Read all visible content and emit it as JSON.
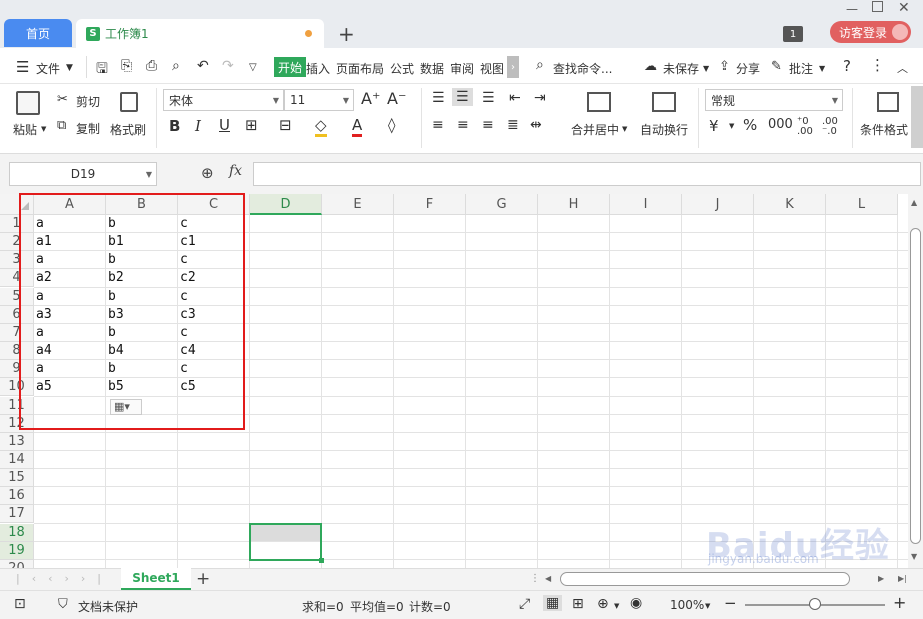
{
  "tabs": {
    "home": "首页",
    "workbook": "工作簿1",
    "workbook_logo": "S"
  },
  "titlebar": {
    "badge": "1",
    "login": "访客登录"
  },
  "menu": {
    "file": "文件",
    "start": "开始",
    "insert": "插入",
    "page_layout": "页面布局",
    "formula": "公式",
    "data": "数据",
    "review": "审阅",
    "view": "视图",
    "search": "查找命令...",
    "unsaved": "未保存",
    "share": "分享",
    "comment": "批注"
  },
  "ribbon": {
    "paste": "粘贴",
    "cut": "剪切",
    "copy": "复制",
    "format_painter": "格式刷",
    "font_name": "宋体",
    "font_size": "11",
    "bold": "B",
    "italic": "I",
    "underline": "U",
    "merge_center": "合并居中",
    "auto_wrap": "自动换行",
    "number_format": "常规",
    "percent": "%",
    "conditional_format": "条件格式"
  },
  "formula_bar": {
    "name_box": "D19",
    "fx": "fx"
  },
  "grid": {
    "columns": [
      "A",
      "B",
      "C",
      "D",
      "E",
      "F",
      "G",
      "H",
      "I",
      "J",
      "K",
      "L"
    ],
    "rows": [
      "1",
      "2",
      "3",
      "4",
      "5",
      "6",
      "7",
      "8",
      "9",
      "10",
      "11",
      "12",
      "13",
      "14",
      "15",
      "16",
      "17",
      "18",
      "19",
      "20"
    ],
    "cells": [
      [
        "a",
        "b",
        "c"
      ],
      [
        "a1",
        "b1",
        "c1"
      ],
      [
        "a",
        "b",
        "c"
      ],
      [
        "a2",
        "b2",
        "c2"
      ],
      [
        "a",
        "b",
        "c"
      ],
      [
        "a3",
        "b3",
        "c3"
      ],
      [
        "a",
        "b",
        "c"
      ],
      [
        "a4",
        "b4",
        "c4"
      ],
      [
        "a",
        "b",
        "c"
      ],
      [
        "a5",
        "b5",
        "c5"
      ]
    ]
  },
  "sheets": {
    "active": "Sheet1"
  },
  "status": {
    "protect": "文档未保护",
    "sum": "求和=0",
    "avg": "平均值=0",
    "count": "计数=0",
    "zoom": "100%"
  },
  "watermark": {
    "main": "Baidu经验",
    "sub": "jingyan.baidu.com"
  }
}
